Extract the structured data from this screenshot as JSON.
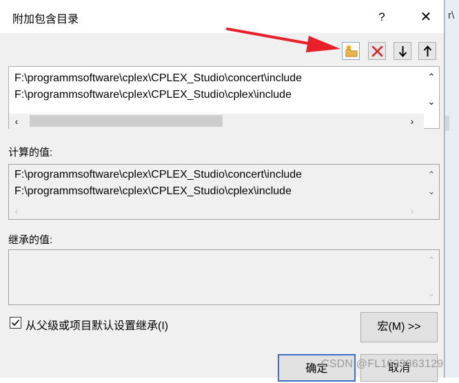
{
  "dialog": {
    "title": "附加包含目录",
    "help_label": "?",
    "close_label": "✕"
  },
  "background_window": {
    "edge_text": "r\\"
  },
  "toolbar": {
    "items": [
      {
        "name": "new-line",
        "icon": "new-folder-icon"
      },
      {
        "name": "delete",
        "icon": "delete-x-icon"
      },
      {
        "name": "move-down",
        "icon": "arrow-down-icon"
      },
      {
        "name": "move-up",
        "icon": "arrow-up-icon"
      }
    ]
  },
  "directories": {
    "lines": [
      "F:\\programmsoftware\\cplex\\CPLEX_Studio\\concert\\include",
      "F:\\programmsoftware\\cplex\\CPLEX_Studio\\cplex\\include"
    ]
  },
  "computed": {
    "label": "计算的值:",
    "lines": [
      "F:\\programmsoftware\\cplex\\CPLEX_Studio\\concert\\include",
      "F:\\programmsoftware\\cplex\\CPLEX_Studio\\cplex\\include"
    ]
  },
  "inherited": {
    "label": "继承的值:",
    "lines": []
  },
  "inherit_checkbox": {
    "label": "从父级或项目默认设置继承(I)",
    "checked": true
  },
  "buttons": {
    "macro": "宏(M) >>",
    "ok": "确定",
    "cancel": "取消"
  },
  "watermark": "CSDN @FL1623863129",
  "colors": {
    "annotation_arrow": "#e8202a",
    "delete_icon": "#d42020",
    "folder_icon": "#e8b64a"
  }
}
